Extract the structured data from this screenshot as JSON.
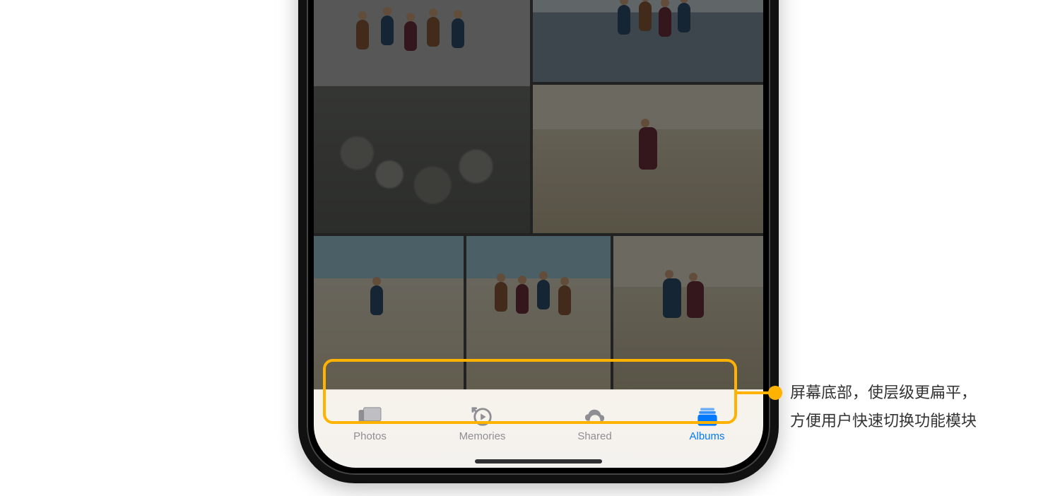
{
  "tabbar": {
    "active_index": 3,
    "items": [
      {
        "label": "Photos",
        "icon": "photos-icon"
      },
      {
        "label": "Memories",
        "icon": "memories-icon"
      },
      {
        "label": "Shared",
        "icon": "shared-icon"
      },
      {
        "label": "Albums",
        "icon": "albums-icon"
      }
    ]
  },
  "callout": {
    "line1": "屏幕底部，使层级更扁平，",
    "line2": "方便用户快速切换功能模块"
  },
  "colors": {
    "accent": "#0079ff",
    "highlight": "#ffb300",
    "inactive": "#8e8e93"
  }
}
